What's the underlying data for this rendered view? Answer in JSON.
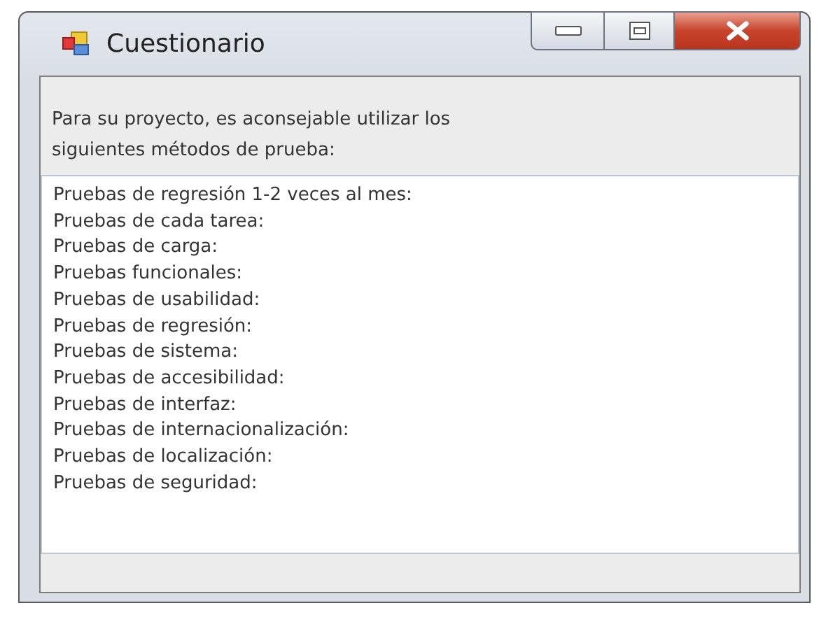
{
  "window": {
    "title": "Cuestionario"
  },
  "intro": "Para su proyecto, es aconsejable utilizar los siguientes métodos de prueba:",
  "results": [
    "Pruebas de regresión 1-2 veces al mes:",
    "Pruebas de cada tarea:",
    "Pruebas de carga:",
    "Pruebas funcionales:",
    "Pruebas de usabilidad:",
    "Pruebas de regresión:",
    "Pruebas de sistema:",
    "Pruebas de accesibilidad:",
    "Pruebas de interfaz:",
    "Pruebas de internacionalización:",
    "Pruebas de localización:",
    "Pruebas de seguridad:"
  ]
}
